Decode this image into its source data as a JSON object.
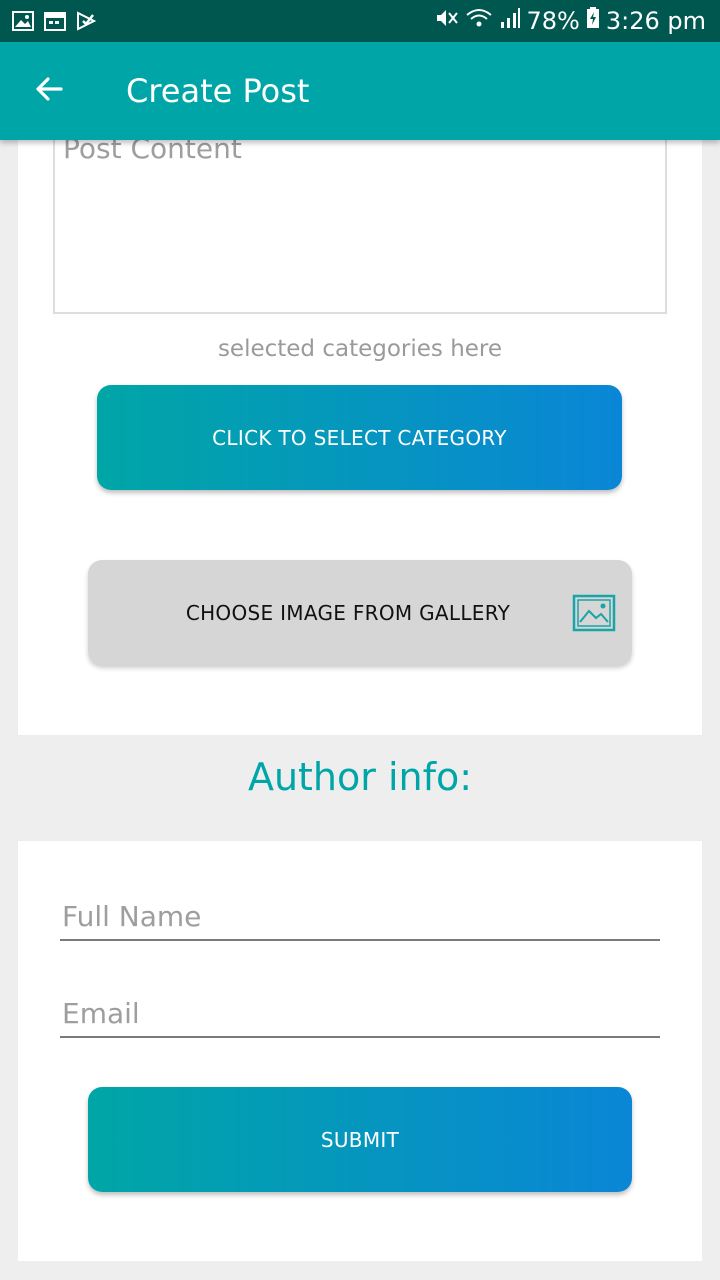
{
  "status_bar": {
    "battery": "78%",
    "time": "3:26 pm",
    "left_icons": [
      "gallery-icon",
      "calendar-icon",
      "check-icon"
    ],
    "right_icons": [
      "mute-icon",
      "wifi-icon",
      "signal-icon",
      "battery-icon"
    ]
  },
  "app_bar": {
    "title": "Create Post",
    "back_icon": "arrow-back-icon",
    "color": "#00a5a7"
  },
  "form": {
    "post_content_placeholder": "Post Content",
    "selected_categories": "selected categories here",
    "select_category_label": "CLICK TO SELECT CATEGORY",
    "gallery_label": "CHOOSE IMAGE FROM GALLERY",
    "gallery_icon": "image-icon"
  },
  "author": {
    "heading": "Author info:",
    "full_name_placeholder": "Full Name",
    "email_placeholder": "Email",
    "submit_label": "SUBMIT"
  },
  "colors": {
    "accent": "#00a5a7",
    "gradient_start": "#00a6a6",
    "gradient_end": "#0a86d6"
  }
}
